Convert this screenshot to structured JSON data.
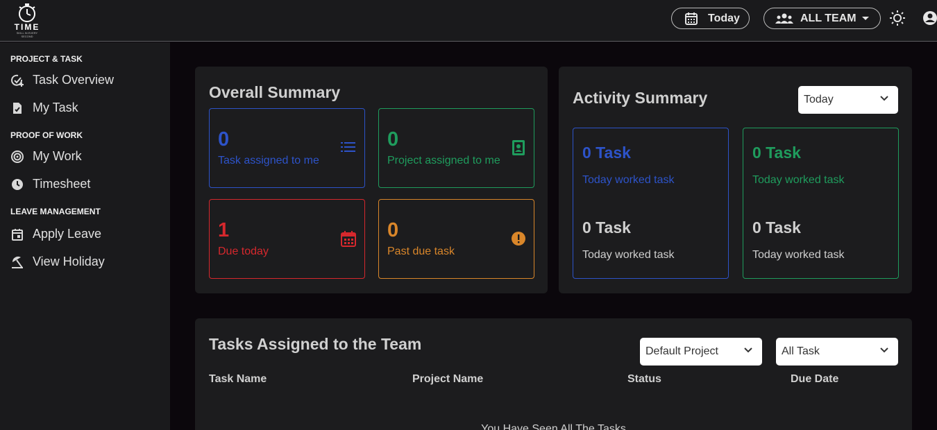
{
  "header": {
    "logo_text": "TIME",
    "logo_sub": "SKILL IN EVERY SECOND",
    "date_label": "Today",
    "team_label": "ALL TEAM"
  },
  "sidebar": {
    "sections": [
      {
        "title": "PROJECT & TASK",
        "items": [
          {
            "label": "Task Overview",
            "icon": "task-check-icon"
          },
          {
            "label": "My Task",
            "icon": "task-file-icon"
          }
        ]
      },
      {
        "title": "PROOF OF WORK",
        "items": [
          {
            "label": "My Work",
            "icon": "target-icon"
          },
          {
            "label": "Timesheet",
            "icon": "clock-icon"
          }
        ]
      },
      {
        "title": "LEAVE MANAGEMENT",
        "items": [
          {
            "label": "Apply Leave",
            "icon": "calendar-icon"
          },
          {
            "label": "View Holiday",
            "icon": "beach-umbrella-icon"
          }
        ]
      }
    ]
  },
  "overall": {
    "title": "Overall Summary",
    "stats": [
      {
        "value": "0",
        "label": "Task assigned to me",
        "color": "#2d53c9"
      },
      {
        "value": "0",
        "label": "Project assigned to me",
        "color": "#1f9c5d"
      },
      {
        "value": "1",
        "label": "Due today",
        "color": "#d6282d"
      },
      {
        "value": "0",
        "label": "Past due task",
        "color": "#d9862a"
      }
    ]
  },
  "activity": {
    "title": "Activity Summary",
    "filter": "Today",
    "cards": [
      {
        "value": "0 Task",
        "label": "Today worked task",
        "value2": "0 Task",
        "label2": "Today worked task",
        "color": "#2d53c9"
      },
      {
        "value": "0 Task",
        "label": "Today worked task",
        "value2": "0 Task",
        "label2": "Today worked task",
        "color": "#1f9c5d"
      }
    ]
  },
  "tasks": {
    "title": "Tasks Assigned to the Team",
    "project_filter": "Default Project",
    "task_filter": "All Task",
    "columns": [
      "Task Name",
      "Project Name",
      "Status",
      "Due Date"
    ],
    "empty_message": "You Have Seen All The Tasks"
  }
}
